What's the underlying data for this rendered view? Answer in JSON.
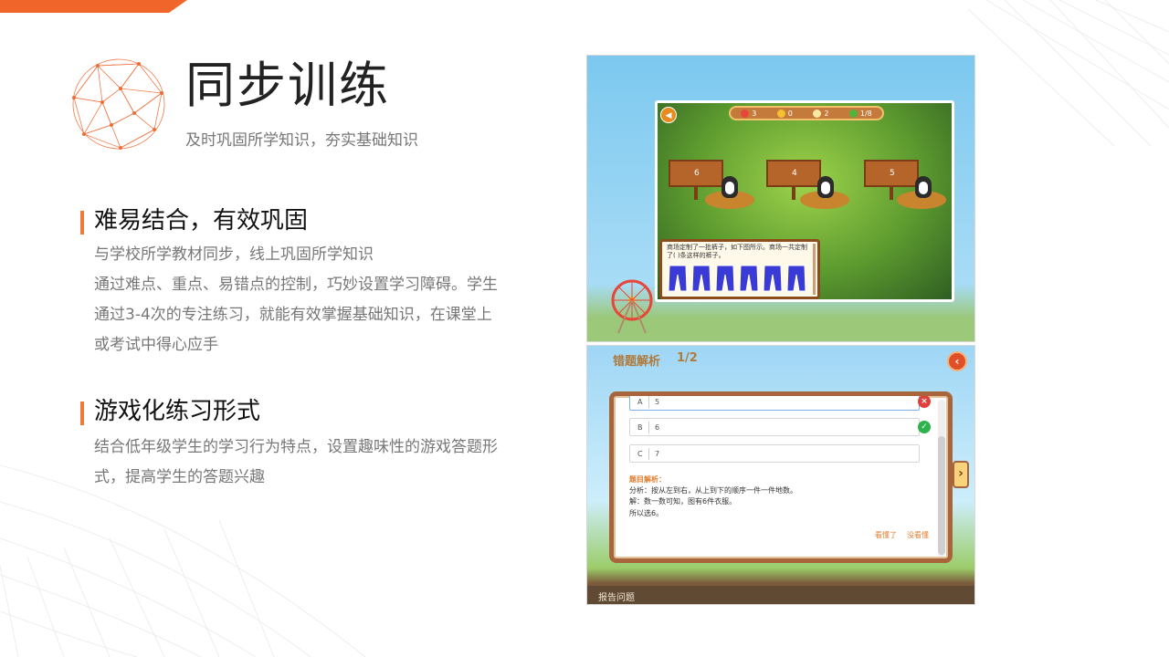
{
  "header": {
    "title": "同步训练",
    "subtitle": "及时巩固所学知识，夯实基础知识"
  },
  "sections": [
    {
      "heading": "难易结合，有效巩固",
      "lines": [
        "与学校所学教材同步，线上巩固所学知识",
        "通过难点、重点、易错点的控制，巧妙设置学习障碍。学生",
        "通过3-4次的专注练习，就能有效掌握基础知识，在课堂上",
        "或考试中得心应手"
      ]
    },
    {
      "heading": "游戏化练习形式",
      "lines": [
        "结合低年级学生的学习行为特点，设置趣味性的游戏答题形",
        "式，提高学生的答题兴趣"
      ]
    }
  ],
  "game": {
    "sound_icon": "speaker-icon",
    "hud": [
      {
        "icon": "heart-icon",
        "value": "3",
        "color": "#e8463a"
      },
      {
        "icon": "coin-icon",
        "value": "0",
        "color": "#f2c230"
      },
      {
        "icon": "star-icon",
        "value": "2",
        "color": "#fbe9a3"
      },
      {
        "icon": "progress-icon",
        "value": "1/8",
        "color": "#4fb43d"
      }
    ],
    "answers": [
      "6",
      "4",
      "5"
    ],
    "question": "商场定制了一批裤子，如下图所示。商场一共定制了(  )条这样的裤子。"
  },
  "review": {
    "title": "错题解析",
    "count": "1/2",
    "options": [
      {
        "letter": "A",
        "text": "5",
        "status": "wrong"
      },
      {
        "letter": "B",
        "text": "6",
        "status": "right"
      },
      {
        "letter": "C",
        "text": "7",
        "status": "none"
      }
    ],
    "analysis_heading": "题目解析：",
    "analysis_lines": [
      "分析：按从左到右，从上到下的顺序一件一件地数。",
      "解：数一数可知，图有6件衣服。",
      "所以选6。"
    ],
    "understood": "看懂了",
    "not_understood": "没看懂",
    "report": "报告问题",
    "back_icon": "back-arrow-icon",
    "next_icon": "chevron-right-icon"
  },
  "colors": {
    "accent": "#ee7b3a",
    "title": "#222222",
    "body": "#777777"
  }
}
